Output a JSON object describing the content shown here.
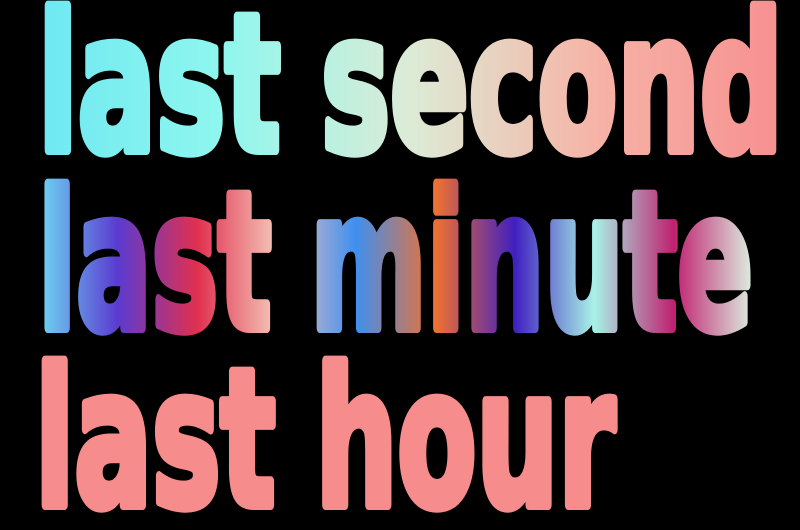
{
  "lines": [
    {
      "text": "last second",
      "colors": [
        "#6fe8f2",
        "#8ff7ee",
        "#dcebd6",
        "#f6b3a6",
        "#f79090"
      ]
    },
    {
      "text": "last minute",
      "colors": [
        "#6fd9f4",
        "#5a3bd0",
        "#e0304f",
        "#f4c6b8",
        "#3f8ff0",
        "#f07030",
        "#4020c0",
        "#a8f2e8",
        "#c02070",
        "#dcf0e0"
      ]
    },
    {
      "text": "last hour",
      "colors": [
        "#f78c8c",
        "#f78c8c"
      ]
    }
  ],
  "background": "#000000"
}
